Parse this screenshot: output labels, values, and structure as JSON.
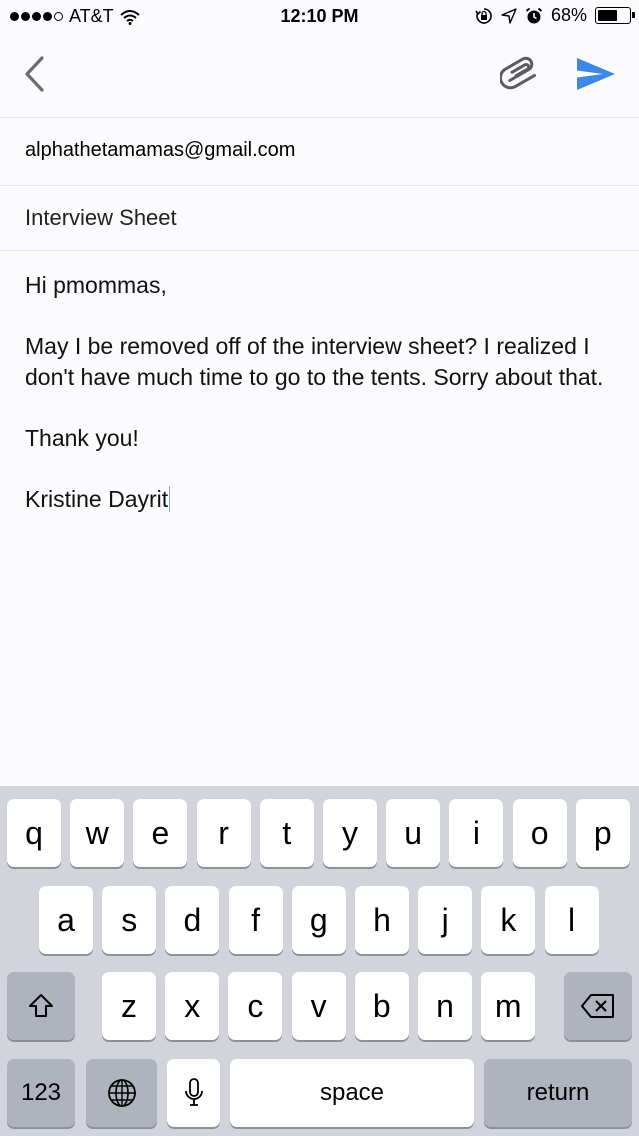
{
  "status_bar": {
    "carrier": "AT&T",
    "time": "12:10 PM",
    "battery_percent_label": "68%",
    "battery_level": 0.68,
    "icons": [
      "signal-dots-icon",
      "wifi-icon",
      "orientation-lock-icon",
      "location-icon",
      "alarm-icon",
      "battery-icon"
    ]
  },
  "nav": {
    "icons": [
      "back-chevron-icon",
      "paperclip-icon",
      "send-icon"
    ],
    "accent_color": "#3d87e6"
  },
  "compose": {
    "to": "alphathetamamas@gmail.com",
    "subject": "Interview Sheet",
    "body": {
      "greeting": "Hi pmommas,",
      "paragraph": "May I be removed off of the interview sheet? I realized I don't have much time to go to the tents. Sorry about that.",
      "closing": "Thank you!",
      "signature": "Kristine Dayrit"
    }
  },
  "keyboard": {
    "row1": [
      "q",
      "w",
      "e",
      "r",
      "t",
      "y",
      "u",
      "i",
      "o",
      "p"
    ],
    "row2": [
      "a",
      "s",
      "d",
      "f",
      "g",
      "h",
      "j",
      "k",
      "l"
    ],
    "row3": [
      "z",
      "x",
      "c",
      "v",
      "b",
      "n",
      "m"
    ],
    "numbers_label": "123",
    "space_label": "space",
    "return_label": "return",
    "icons": [
      "shift-icon",
      "backspace-icon",
      "globe-icon",
      "microphone-icon"
    ]
  }
}
